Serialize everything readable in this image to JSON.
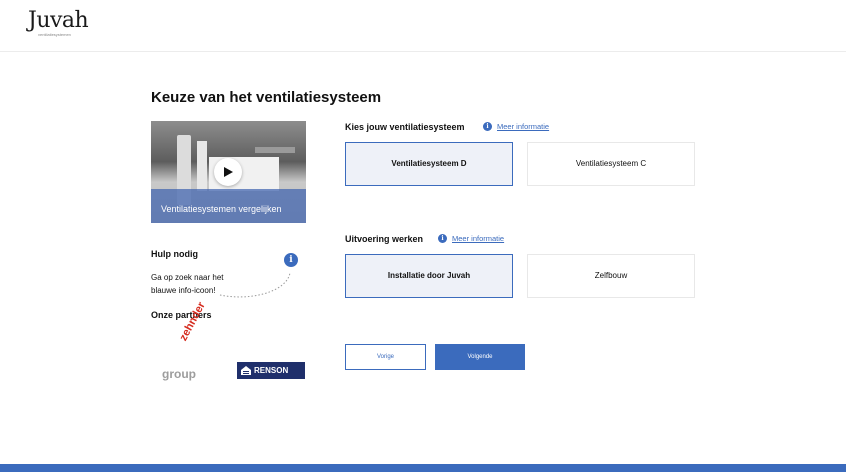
{
  "brand": {
    "name": "Juvah",
    "tagline": "ventilatiesystemen"
  },
  "page": {
    "title": "Keuze van het ventilatiesysteem"
  },
  "video": {
    "caption": "Ventilatiesystemen vergelijken"
  },
  "help": {
    "title": "Hulp nodig",
    "text": "Ga op zoek naar het blauwe info-icoon!",
    "info_glyph": "i"
  },
  "partners": {
    "title": "Onze partners",
    "zehnder_top": "zehnder",
    "zehnder_bottom": "group",
    "renson": "RENSON"
  },
  "system": {
    "title": "Kies jouw ventilatiesysteem",
    "info_link": "Meer informatie",
    "options": [
      {
        "label": "Ventilatiesysteem D",
        "selected": true
      },
      {
        "label": "Ventilatiesysteem C",
        "selected": false
      }
    ]
  },
  "execution": {
    "title": "Uitvoering werken",
    "info_link": "Meer informatie",
    "options": [
      {
        "label": "Installatie door Juvah",
        "selected": true
      },
      {
        "label": "Zelfbouw",
        "selected": false
      }
    ]
  },
  "nav": {
    "prev_label": "Vorige",
    "next_label": "Volgende"
  },
  "colors": {
    "accent": "#3b6bbd",
    "zehnder_red": "#d52b1e",
    "renson_navy": "#1f2f6b"
  }
}
